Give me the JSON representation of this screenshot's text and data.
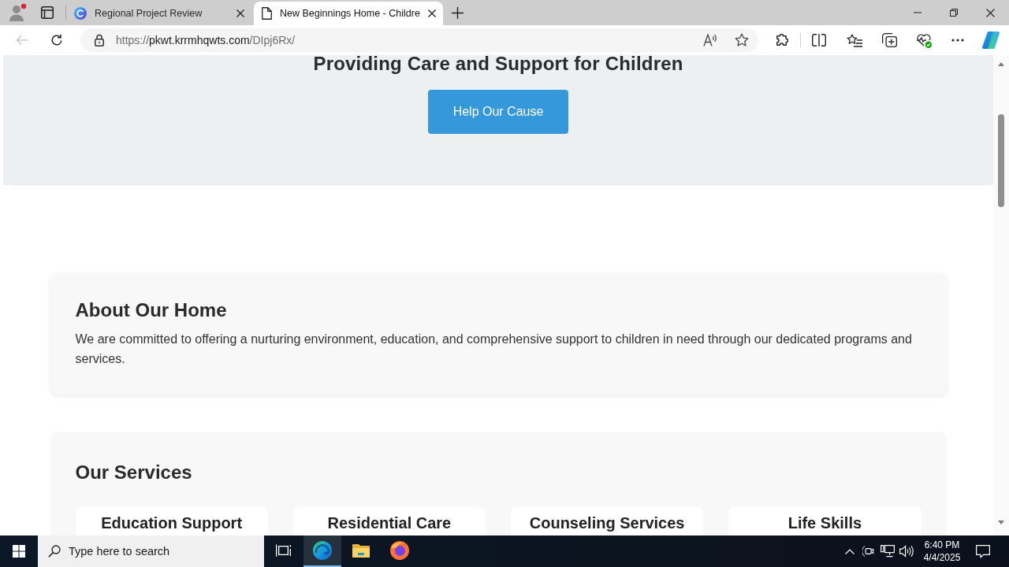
{
  "browser": {
    "tabs": [
      {
        "kind": "site",
        "title": "Regional Project Review",
        "selected": false
      },
      {
        "kind": "page",
        "title": "New Beginnings Home - Childre",
        "selected": true
      }
    ],
    "back_disabled": true,
    "address": {
      "scheme": "https://",
      "host": "pkwt.krrmhqwts.com",
      "path": "/DIpj6Rx/"
    }
  },
  "page": {
    "hero": {
      "title": "Providing Care and Support for Children",
      "button": "Help Our Cause"
    },
    "about": {
      "heading": "About Our Home",
      "text": "We are committed to offering a nurturing environment, education, and comprehensive support to children in need through our dedicated programs and services."
    },
    "services": {
      "heading": "Our Services",
      "items": [
        "Education Support",
        "Residential Care",
        "Counseling Services",
        "Life Skills"
      ]
    }
  },
  "taskbar": {
    "search": {
      "placeholder": "Type here to search"
    },
    "apps": [
      {
        "kind": "task-view",
        "selected": false
      },
      {
        "kind": "browser",
        "selected": true
      },
      {
        "kind": "folder",
        "selected": false
      },
      {
        "kind": "fox",
        "selected": false
      }
    ],
    "time": "6:40 PM",
    "date": "4/4/2025"
  }
}
